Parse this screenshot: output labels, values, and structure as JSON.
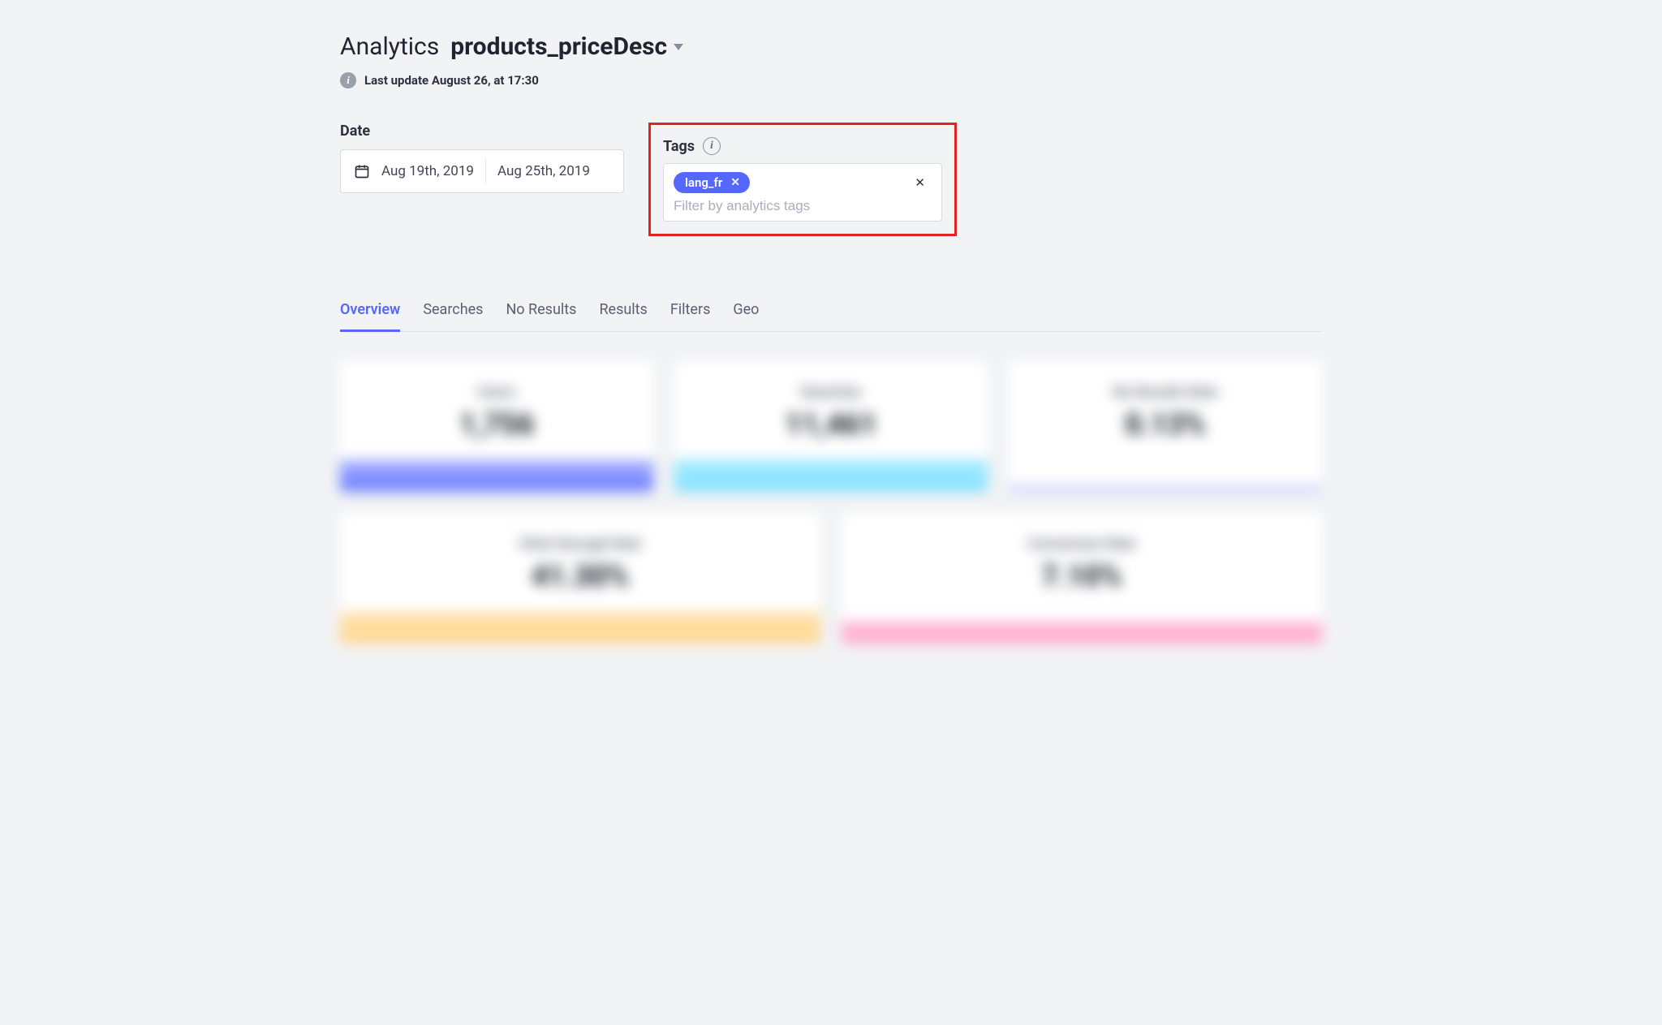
{
  "header": {
    "title": "Analytics",
    "index_name": "products_priceDesc",
    "last_update": "Last update August 26, at 17:30"
  },
  "filters": {
    "date_label": "Date",
    "date_from": "Aug 19th, 2019",
    "date_to": "Aug 25th, 2019",
    "tags_label": "Tags",
    "tag_chip": "lang_fr",
    "tags_placeholder": "Filter by analytics tags"
  },
  "tabs": [
    {
      "label": "Overview",
      "active": true
    },
    {
      "label": "Searches",
      "active": false
    },
    {
      "label": "No Results",
      "active": false
    },
    {
      "label": "Results",
      "active": false
    },
    {
      "label": "Filters",
      "active": false
    },
    {
      "label": "Geo",
      "active": false
    }
  ],
  "cards_row1": [
    {
      "title": "Users",
      "value": "1,756",
      "accent": "blue"
    },
    {
      "title": "Searches",
      "value": "11,461",
      "accent": "cyan"
    },
    {
      "title": "No Results Rate",
      "value": "0.13%",
      "accent": "thin"
    }
  ],
  "cards_row2": [
    {
      "title": "Click-through Rate",
      "value": "41.30%",
      "accent": "yellow"
    },
    {
      "title": "Conversion Rate",
      "value": "7.10%",
      "accent": "pink"
    }
  ]
}
